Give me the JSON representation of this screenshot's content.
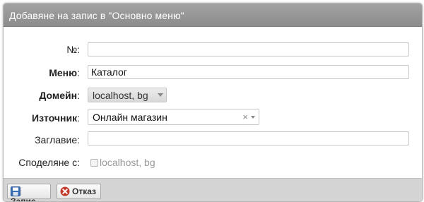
{
  "dialog": {
    "title": "Добавяне на запис в \"Основно меню\""
  },
  "form": {
    "number": {
      "label": "№:",
      "value": ""
    },
    "menu": {
      "label": "Меню",
      "colon": ":",
      "value": "Каталог"
    },
    "domain": {
      "label": "Домейн",
      "colon": ":",
      "value": "localhost, bg"
    },
    "source": {
      "label": "Източник",
      "colon": ":",
      "value": "Онлайн магазин",
      "clear": "×"
    },
    "title": {
      "label": "Заглавие:",
      "value": ""
    },
    "share": {
      "label": "Споделяне с:",
      "option": "localhost, bg"
    }
  },
  "footer": {
    "save_label": "Запис",
    "cancel_label": "Отказ"
  },
  "colors": {
    "titlebar": "#999999",
    "cancel_icon": "#c0392b",
    "save_icon": "#3b6fb5"
  }
}
